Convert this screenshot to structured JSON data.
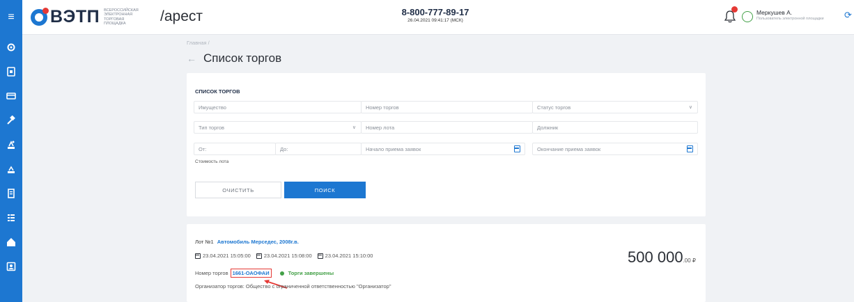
{
  "header": {
    "logo_text": "ВЭТП",
    "logo_subtitle": "ВСЕРОССИЙСКАЯ ЭЛЕКТРОННАЯ ТОРГОВАЯ ПЛОЩАДКА",
    "section": "/арест",
    "phone": "8-800-777-89-17",
    "datetime": "26.04.2021 09:41:17 (МСК)",
    "user_name": "Меркушев А.",
    "user_role": "Пользователь электронной площадки"
  },
  "sidebar": {
    "items": [
      "settings-icon",
      "document-icon",
      "card-icon",
      "hammer-icon",
      "auction-icon",
      "auction-2-icon",
      "file-icon",
      "list-icon",
      "home-icon",
      "profile-icon"
    ]
  },
  "breadcrumb": "Главная /",
  "page_title": "Список торгов",
  "filters": {
    "title": "СПИСОК ТОРГОВ",
    "property_placeholder": "Имущество",
    "auction_number_placeholder": "Номер торгов",
    "status_placeholder": "Статус торгов",
    "auction_type_placeholder": "Тип торгов",
    "lot_number_placeholder": "Номер лота",
    "debtor_placeholder": "Должник",
    "from_placeholder": "От:",
    "to_placeholder": "До:",
    "start_placeholder": "Начало приема заявок",
    "end_placeholder": "Окончание приема заявок",
    "cost_label": "Стоимость лота",
    "clear_label": "ОЧИСТИТЬ",
    "search_label": "ПОИСК"
  },
  "lot": {
    "lot_prefix": "Лот №1",
    "lot_title": "Автомобиль Мерседес, 2008г.в.",
    "date1": "23.04.2021 15:05:00",
    "date2": "23.04.2021 15:08:00",
    "date3": "23.04.2021 15:10:00",
    "price": "500 000",
    "price_kop": ".00 ₽",
    "number_label": "Номер торгов",
    "number_value": "1661-ОАОФАИ",
    "status": "Торги завершены",
    "organizer": "Организатор торгов: Общество с ограниченной ответственностью \"Организатор\""
  },
  "colors": {
    "brand_blue": "#1d77d1",
    "status_green": "#43a047",
    "highlight_red": "#e53935"
  }
}
